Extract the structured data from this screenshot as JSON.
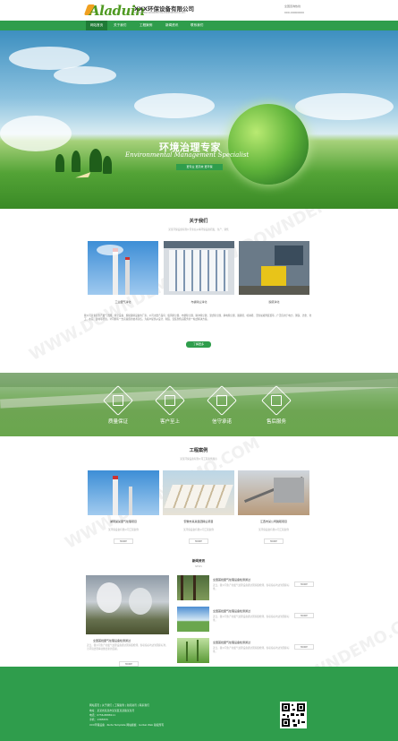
{
  "header": {
    "logo_text": "Aladuin",
    "company_name": "XXX环保设备有限公司",
    "company_sub": "XXXXXXENVIRONMENTALEQUIPMENTCO.LTD",
    "contact_line1": "全国咨询热线",
    "contact_line2": "000-00000000"
  },
  "nav": {
    "items": [
      "网站首页",
      "关于我们",
      "工程案例",
      "新闻资讯",
      "联系我们"
    ]
  },
  "banner": {
    "title_cn": "环境治理专家",
    "title_en": "Environmental Management Specialist",
    "tag": "更专业 更高效 更环保"
  },
  "about": {
    "title": "关于我们",
    "subtitle": "某某环保设备有限公司专业从事环保设备研发、生产、销售",
    "items": [
      {
        "caption": "工业废气净化"
      },
      {
        "caption": "布袋除尘净化"
      },
      {
        "caption": "脱硫净化"
      }
    ],
    "text": "我公司是专业生产废气治理、除尘设备、脱硫脱硝设备的厂家，公司主要产品有：旋风除尘器、布袋除尘器、脉冲除尘器、湿式除尘器、静电除尘器、脱硫塔、喷淋塔、活性炭吸附装置等，广泛应用于电力、钢铁、冶金、化工、水泥、建材等行业。公司拥有一支高素质的技术队伍，为客户提供从设计、制造、安装到售后服务的一站式解决方案。",
    "button": "了解更多"
  },
  "values": {
    "items": [
      {
        "label": "质量保证",
        "icon": "shield-icon"
      },
      {
        "label": "客户至上",
        "icon": "envelope-icon"
      },
      {
        "label": "信守承诺",
        "icon": "handshake-icon"
      },
      {
        "label": "售后服务",
        "icon": "headset-icon"
      }
    ]
  },
  "cases": {
    "title": "工程案例",
    "subtitle": "某某环保设备有限公司工程案例展示",
    "items": [
      {
        "title": "湖南某某废气处理项目",
        "desc": "某环保设备有限公司工程案例",
        "more": "MORE"
      },
      {
        "title": "安徽市某某集团除尘项目",
        "desc": "某环保设备有限公司工程案例",
        "more": "MORE"
      },
      {
        "title": "江西市某公司脱硫项目",
        "desc": "某环保设备有限公司工程案例",
        "more": "MORE"
      }
    ]
  },
  "news": {
    "title": "新闻资讯",
    "subtitle": "NEWS",
    "featured": {
      "title": "全国首批废气处理设备检测通过",
      "desc": "近日，我公司生产的废气处理设备通过国家级检测，各项指标均达到国家标准，为环境治理事业做出新的贡献。",
      "more": "MORE"
    },
    "items": [
      {
        "title": "全国首批废气处理设备检测通过",
        "desc": "近日，我公司生产的废气处理设备通过国家级检测，各项指标均达到国家标准。",
        "more": "MORE"
      },
      {
        "title": "全国首批废气处理设备检测通过",
        "desc": "近日，我公司生产的废气处理设备通过国家级检测，各项指标均达到国家标准。",
        "more": "MORE"
      },
      {
        "title": "全国首批废气处理设备检测通过",
        "desc": "近日，我公司生产的废气处理设备通过国家级检测，各项指标均达到国家标准。",
        "more": "MORE"
      }
    ]
  },
  "footer": {
    "links": "网站首页 | 关于我们 | 工程案例 | 新闻资讯 | 联系我们",
    "address": "地址：某某省某某市某某区某某路某某号",
    "phone": "电话：0756-8888111",
    "mobile": "手机：1385555",
    "copyright": "XXX环保设备 · Ruite Template 网站模板 · Golbel Web 版权所有"
  },
  "colors": {
    "brand_green": "#2f9d4c",
    "logo_green": "#4f9a22",
    "logo_orange": "#f0a020"
  },
  "watermark": "WWW.DOWNDEMO.COM"
}
